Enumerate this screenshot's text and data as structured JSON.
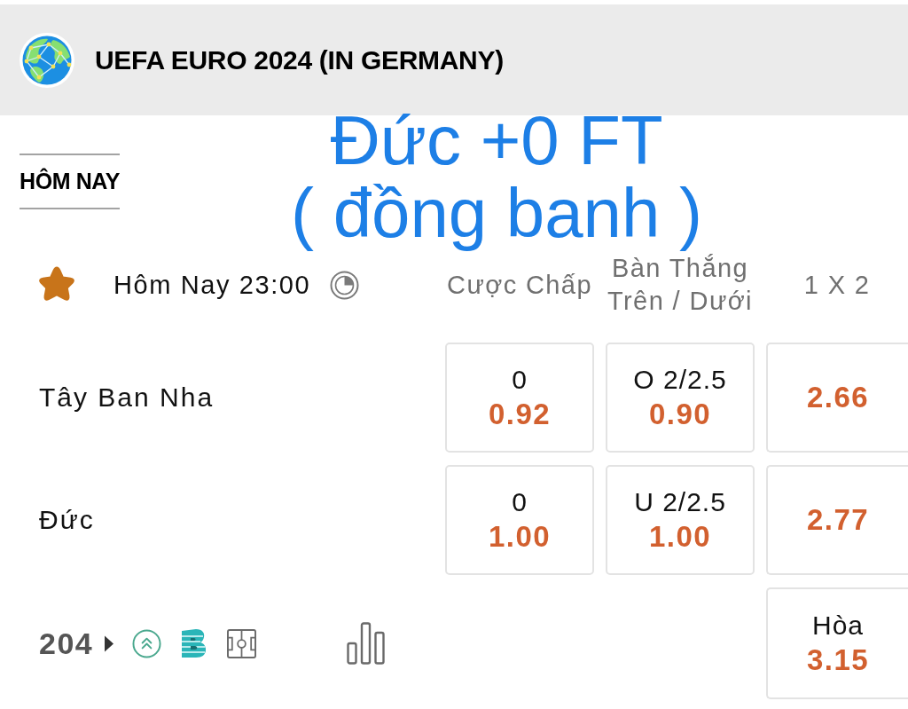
{
  "header": {
    "title": "UEFA EURO 2024 (IN GERMANY)"
  },
  "tabs": [
    {
      "label": "HÔM NAY",
      "selected": true
    }
  ],
  "annotation": {
    "lines": [
      "Đức +0 FT",
      "( đồng banh )"
    ]
  },
  "match": {
    "favorite": true,
    "time": "Hôm Nay 23:00",
    "columns": [
      {
        "lines": [
          "Cược Chấp"
        ]
      },
      {
        "lines": [
          "Bàn Thắng",
          "Trên / Dưới"
        ]
      },
      {
        "lines": [
          "1 X 2"
        ]
      }
    ],
    "rows": [
      {
        "team": "Tây Ban Nha",
        "cells": [
          {
            "line": "0",
            "odds": "0.92"
          },
          {
            "line": "O 2/2.5",
            "odds": "0.90"
          },
          {
            "odds": "2.66"
          }
        ]
      },
      {
        "team": "Đức",
        "cells": [
          {
            "line": "0",
            "odds": "1.00"
          },
          {
            "line": "U 2/2.5",
            "odds": "1.00"
          },
          {
            "odds": "2.77"
          }
        ]
      }
    ],
    "draw": {
      "label": "Hòa",
      "odds": "3.15"
    },
    "market_count": "204"
  }
}
